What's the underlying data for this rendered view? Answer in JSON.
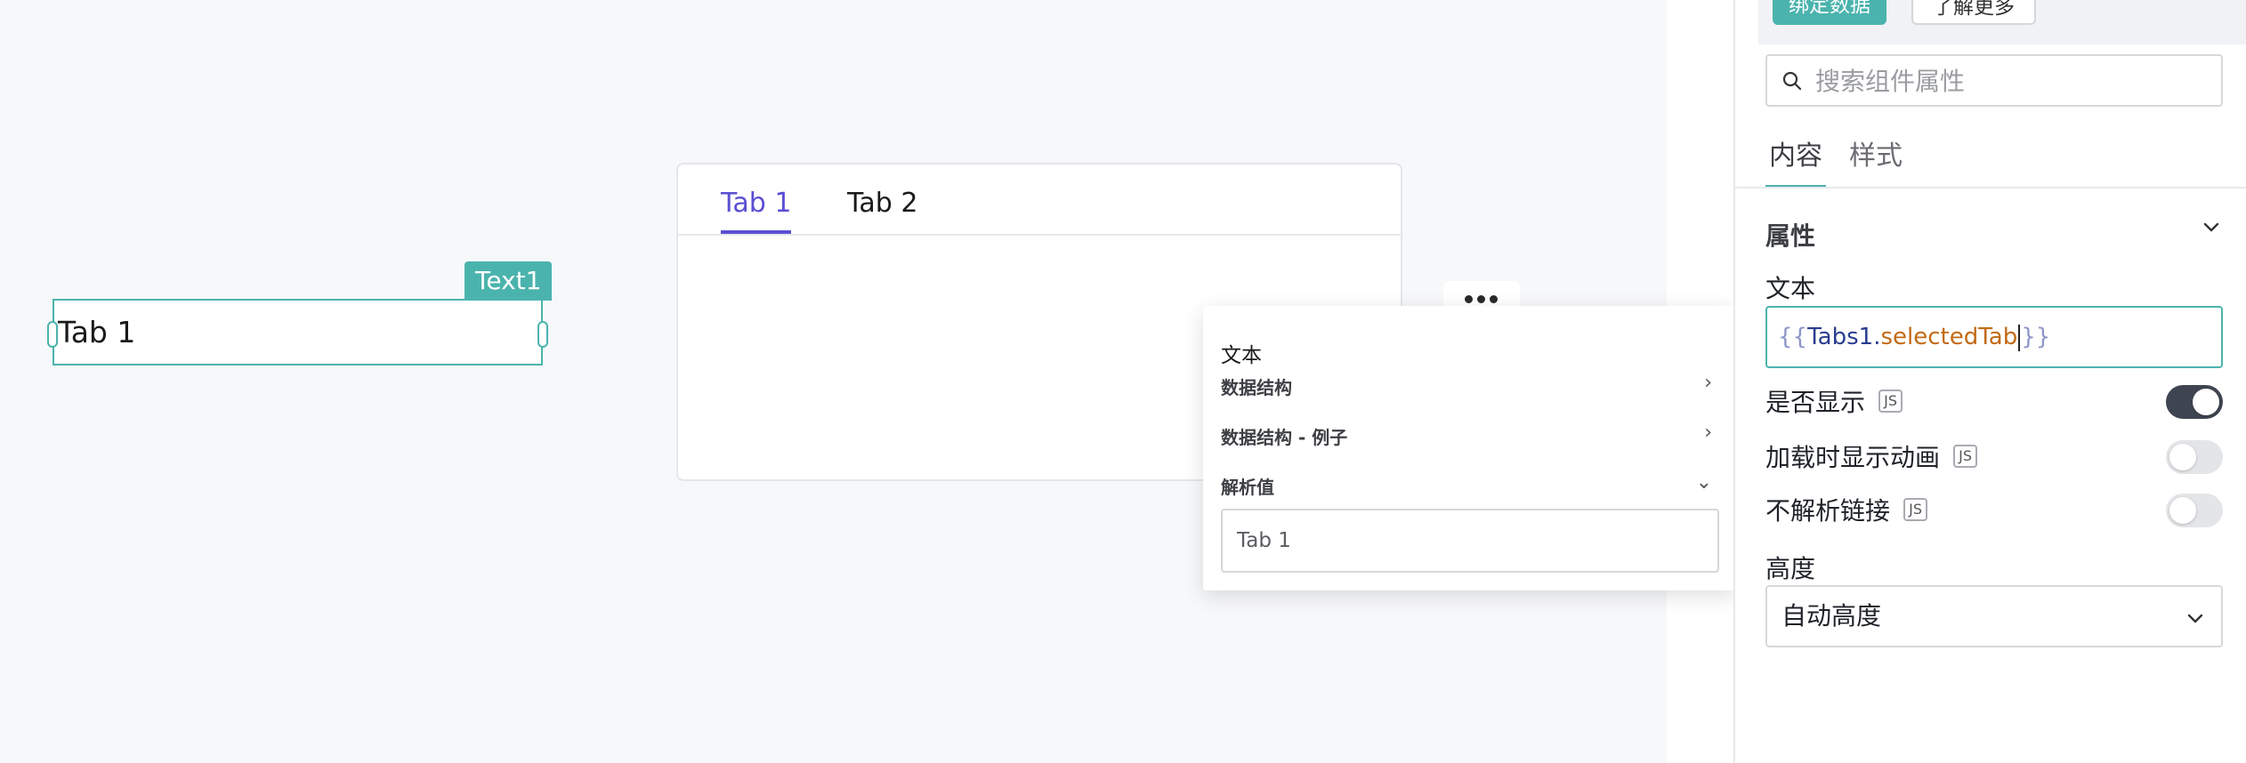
{
  "canvas": {
    "text_widget": {
      "value": "Tab 1",
      "tag": "Text1"
    },
    "tabs_widget": {
      "tabs": [
        {
          "label": "Tab 1",
          "active": true
        },
        {
          "label": "Tab 2",
          "active": false
        }
      ]
    }
  },
  "popover": {
    "title": "文本",
    "rows": {
      "schema": "数据结构",
      "example": "数据结构 - 例子",
      "evaluated": "解析值"
    },
    "evaluated_value": "Tab 1"
  },
  "panel": {
    "bind_data_label": "绑定数据",
    "learn_more_label": "了解更多",
    "search": {
      "placeholder": "搜索组件属性",
      "value": ""
    },
    "tabs": {
      "content": "内容",
      "style": "样式"
    },
    "section": "属性",
    "text_label": "文本",
    "text_binding": {
      "open": "{{",
      "object": "Tabs1",
      "dot": ".",
      "property": "selectedTab",
      "close": "}}"
    },
    "js_badge": "JS",
    "props": {
      "visible": {
        "label": "是否显示",
        "on": true
      },
      "animate": {
        "label": "加载时显示动画",
        "on": false
      },
      "no_link": {
        "label": "不解析链接",
        "on": false
      }
    },
    "height_label": "高度",
    "height_value": "自动高度"
  },
  "colors": {
    "accent": "#4bb3ad",
    "tab_active": "#5b4fd3",
    "toggle_on": "#3f4550"
  },
  "icons": [
    "search-icon",
    "chevron-down-icon",
    "chevron-right-icon",
    "drag-handle-icon"
  ]
}
